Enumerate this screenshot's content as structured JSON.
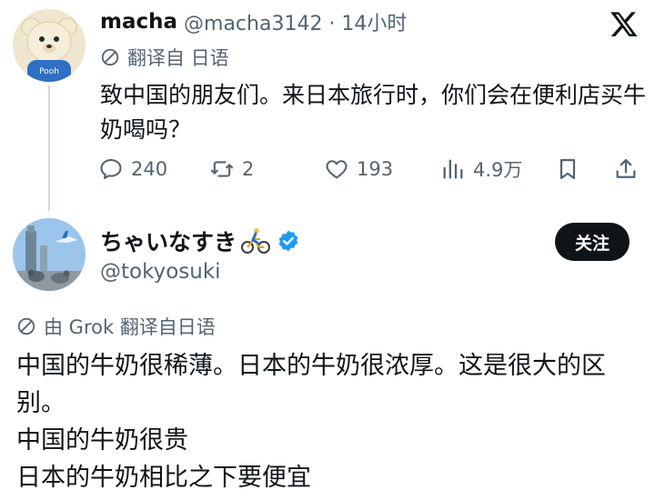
{
  "tweet1": {
    "display_name": "macha",
    "handle_meta": "@macha3142 · 14小时",
    "translated_label": "翻译自 日语",
    "text": "致中国的朋友们。来日本旅行时，你们会在便利店买牛奶喝吗？",
    "avatar_text": "Pooh",
    "actions": {
      "replies": "240",
      "retweets": "2",
      "likes": "193",
      "views": "4.9万"
    }
  },
  "tweet2": {
    "display_name": "ちゃいなすき",
    "handle": "@tokyosuki",
    "follow_label": "关注",
    "translated_label": "由 Grok 翻译自日语",
    "lines": [
      "中国的牛奶很稀薄。日本的牛奶很浓厚。这是很大的区别。",
      "中国的牛奶很贵",
      "日本的牛奶相比之下要便宜"
    ]
  },
  "colors": {
    "text": "#0f1419",
    "secondary": "#536471",
    "verified": "#1d9bf0",
    "button_bg": "#0f1419",
    "thread_line": "#cfd9de"
  },
  "icons": [
    "x-logo-icon",
    "translate-icon",
    "reply-icon",
    "retweet-icon",
    "like-icon",
    "views-icon",
    "bookmark-icon",
    "share-icon",
    "cyclist-emoji-icon",
    "verified-badge-icon"
  ]
}
